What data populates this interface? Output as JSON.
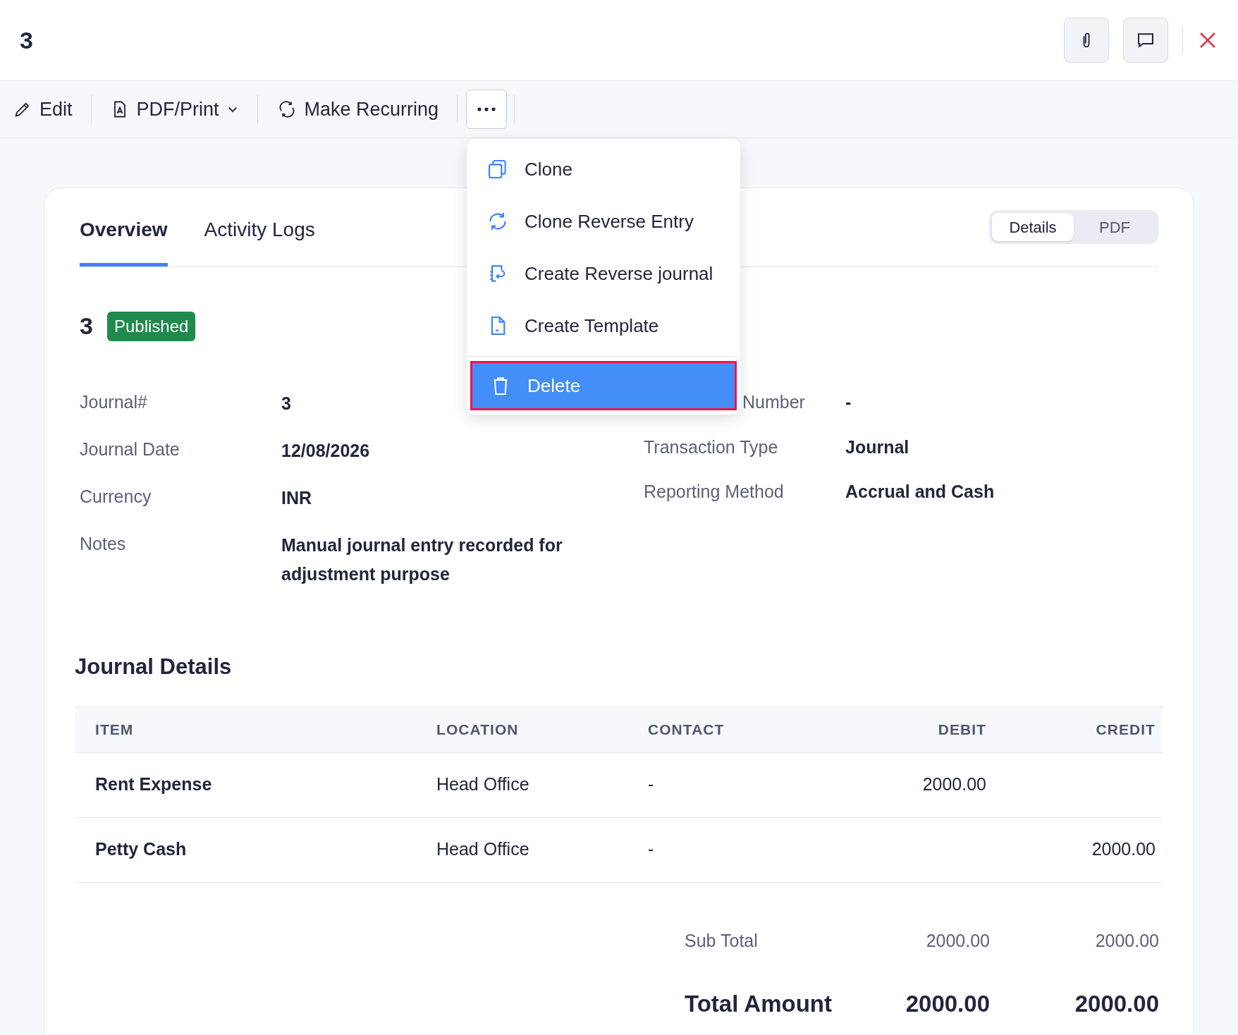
{
  "header": {
    "title": "3"
  },
  "toolbar": [
    {
      "label": "Edit",
      "kind": "edit"
    },
    {
      "label": "PDF/Print",
      "kind": "pdf"
    },
    {
      "label": "Make Recurring",
      "kind": "recurring"
    }
  ],
  "more_menu": {
    "expanded": true,
    "items": [
      {
        "label": "Clone",
        "kind": "clone",
        "selected": false
      },
      {
        "label": "Clone Reverse Entry",
        "kind": "reverse",
        "selected": false
      },
      {
        "label": "Create Reverse journal",
        "kind": "journal",
        "selected": false
      },
      {
        "label": "Create Template",
        "kind": "template",
        "selected": false
      },
      {
        "label": "Delete",
        "kind": "delete",
        "selected": true
      }
    ]
  },
  "tabs": [
    {
      "label": "Overview",
      "selected": true
    },
    {
      "label": "Activity Logs",
      "selected": false
    }
  ],
  "view_toggle": [
    {
      "label": "Details",
      "selected": true
    },
    {
      "label": "PDF",
      "selected": false
    }
  ],
  "entry": {
    "number": "3",
    "status": "Published"
  },
  "details_left": [
    {
      "label": "Journal#",
      "value": "3"
    },
    {
      "label": "Journal Date",
      "value": "12/08/2026"
    },
    {
      "label": "Currency",
      "value": "INR"
    },
    {
      "label": "Notes",
      "value": "Manual journal entry recorded for adjustment purpose"
    }
  ],
  "details_right": [
    {
      "label": "Number",
      "value": "-"
    },
    {
      "label": "Transaction Type",
      "value": "Journal"
    },
    {
      "label": "Reporting Method",
      "value": "Accrual and Cash"
    }
  ],
  "journal_details": {
    "title": "Journal Details",
    "columns": [
      "ITEM",
      "LOCATION",
      "CONTACT",
      "DEBIT",
      "CREDIT"
    ],
    "rows": [
      [
        "Rent Expense",
        "Head Office",
        "-",
        "2000.00",
        ""
      ],
      [
        "Petty Cash",
        "Head Office",
        "-",
        "",
        "2000.00"
      ]
    ],
    "sub_total": {
      "label": "Sub Total",
      "debit": "2000.00",
      "credit": "2000.00"
    },
    "total": {
      "label": "Total Amount",
      "debit": "2000.00",
      "credit": "2000.00"
    }
  }
}
